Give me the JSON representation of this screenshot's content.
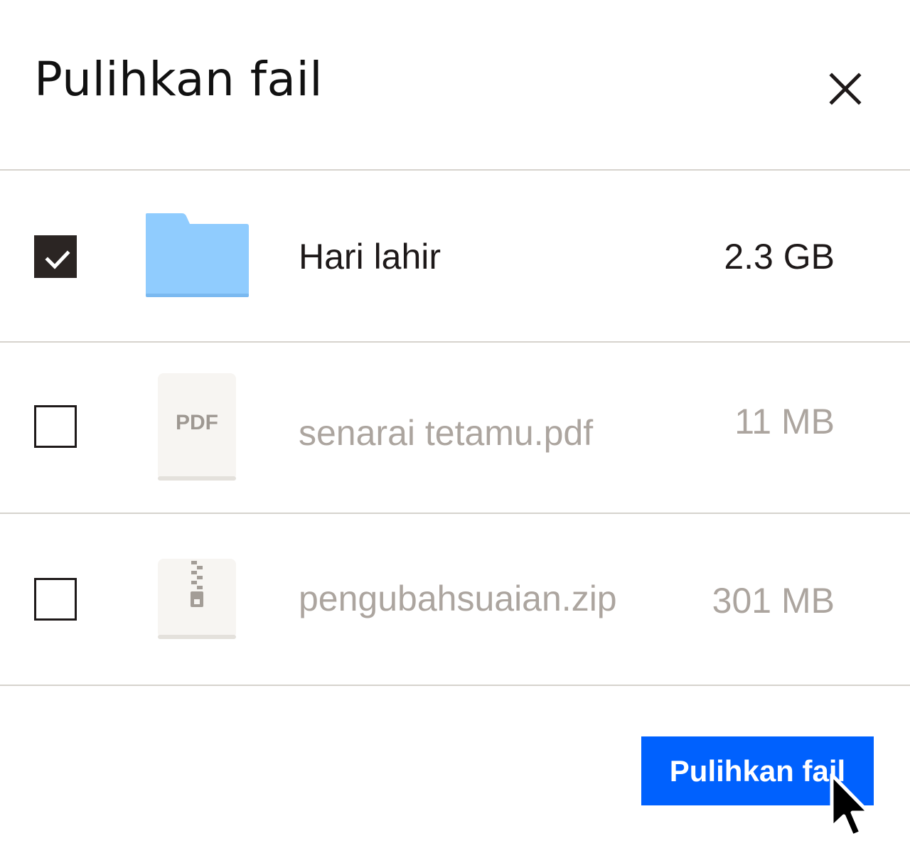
{
  "dialog": {
    "title": "Pulihkan fail",
    "close_icon": "close-icon"
  },
  "files": [
    {
      "name": "Hari lahir",
      "size": "2.3 GB",
      "type": "folder",
      "icon": "folder-icon",
      "checked": true
    },
    {
      "name": "senarai tetamu.pdf",
      "size": "11 MB",
      "type": "pdf",
      "icon": "pdf-file-icon",
      "icon_label": "PDF",
      "checked": false
    },
    {
      "name": "pengubahsuaian.zip",
      "size": "301 MB",
      "type": "zip",
      "icon": "zip-file-icon",
      "checked": false
    }
  ],
  "footer": {
    "restore_label": "Pulihkan fail"
  },
  "colors": {
    "primary_button": "#0061fe",
    "folder": "#90ccfe",
    "checkbox_checked": "#2b2523",
    "muted_text": "#aca59f",
    "divider": "#d6d3cd"
  },
  "pointer": "cursor-arrow-icon"
}
